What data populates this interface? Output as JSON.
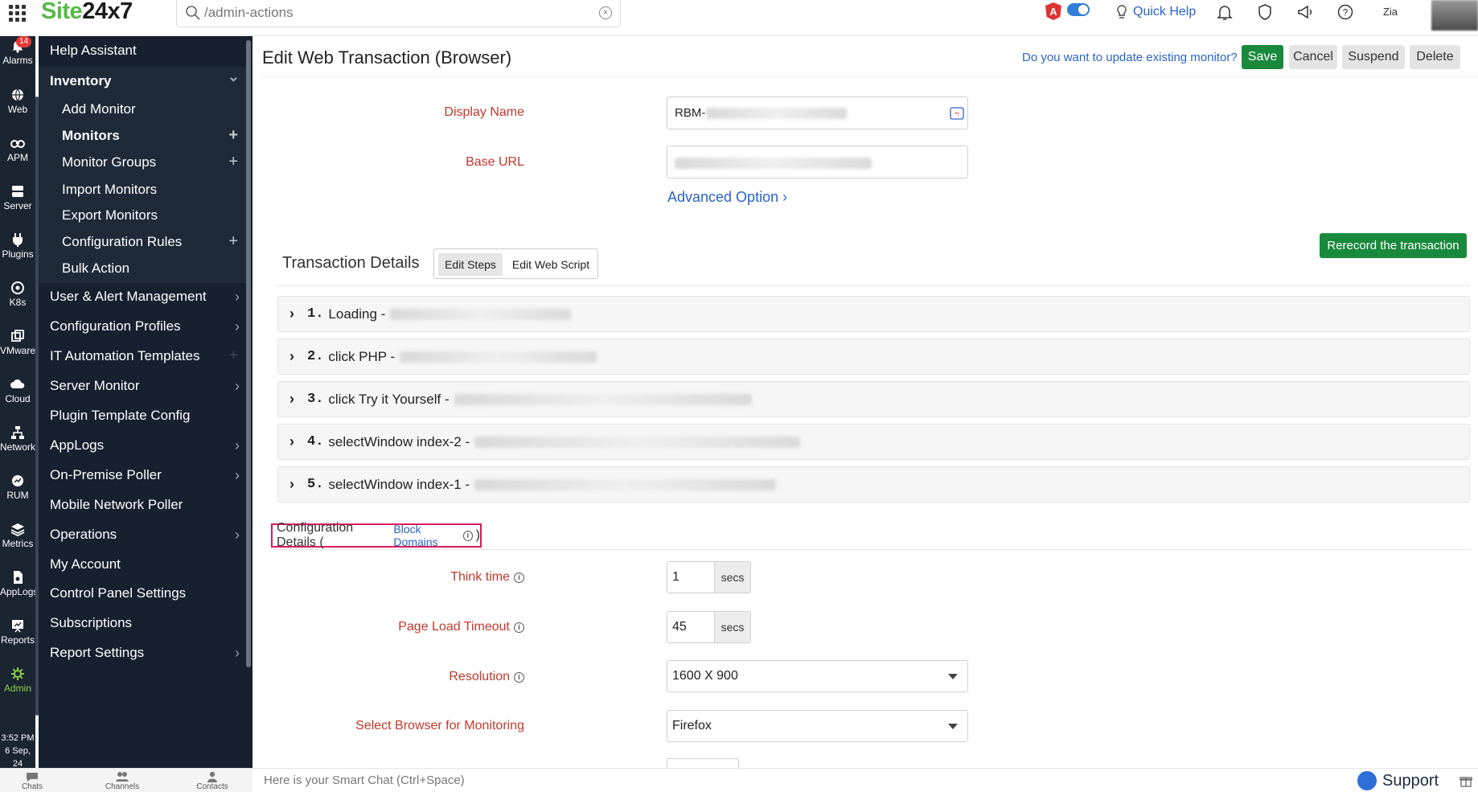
{
  "topbar": {
    "logo_part1": "Site",
    "logo_part2": "24x7",
    "search_value": "/admin-actions",
    "angular_badge": "A",
    "quick_help": "Quick Help"
  },
  "rail": [
    {
      "label": "Alarms",
      "badge": "14",
      "icon": "bell-icon"
    },
    {
      "label": "Web",
      "icon": "globe-icon"
    },
    {
      "label": "APM",
      "icon": "binoculars-icon"
    },
    {
      "label": "Server",
      "icon": "server-icon"
    },
    {
      "label": "Plugins",
      "icon": "plug-icon"
    },
    {
      "label": "K8s",
      "icon": "helm-icon"
    },
    {
      "label": "VMware",
      "icon": "vm-icon"
    },
    {
      "label": "Cloud",
      "icon": "cloud-icon"
    },
    {
      "label": "Network",
      "icon": "network-icon"
    },
    {
      "label": "RUM",
      "icon": "rum-icon"
    },
    {
      "label": "Metrics",
      "icon": "layers-icon"
    },
    {
      "label": "AppLogs",
      "icon": "file-icon"
    },
    {
      "label": "Reports",
      "icon": "chart-icon"
    },
    {
      "label": "Admin",
      "icon": "gear-icon"
    }
  ],
  "rail_time": "3:52 PM",
  "rail_date": "6 Sep, 24",
  "sidebar": [
    {
      "label": "Help Assistant"
    },
    {
      "label": "Inventory",
      "bold": true,
      "open": true
    },
    {
      "label": "Add Monitor",
      "sub": true
    },
    {
      "label": "Monitors",
      "sub": true,
      "bold": true,
      "plus": true
    },
    {
      "label": "Monitor Groups",
      "sub": true,
      "plus": true
    },
    {
      "label": "Import Monitors",
      "sub": true
    },
    {
      "label": "Export Monitors",
      "sub": true
    },
    {
      "label": "Configuration Rules",
      "sub": true,
      "plus": true
    },
    {
      "label": "Bulk Action",
      "sub": true
    },
    {
      "label": "User & Alert Management",
      "arrow": true
    },
    {
      "label": "Configuration Profiles",
      "arrow": true
    },
    {
      "label": "IT Automation Templates",
      "plus": true
    },
    {
      "label": "Server Monitor",
      "arrow": true
    },
    {
      "label": "Plugin Template Config"
    },
    {
      "label": "AppLogs",
      "arrow": true
    },
    {
      "label": "On-Premise Poller",
      "arrow": true
    },
    {
      "label": "Mobile Network Poller"
    },
    {
      "label": "Operations",
      "arrow": true
    },
    {
      "label": "My Account"
    },
    {
      "label": "Control Panel Settings"
    },
    {
      "label": "Subscriptions"
    },
    {
      "label": "Report Settings",
      "arrow": true
    }
  ],
  "bottombar": {
    "chats": "Chats",
    "channels": "Channels",
    "contacts": "Contacts",
    "smart_chat": "Here is your Smart Chat (Ctrl+Space)",
    "support": "Support"
  },
  "main": {
    "title": "Edit Web Transaction (Browser)",
    "update_question": "Do you want to update existing monitor?",
    "save": "Save",
    "cancel": "Cancel",
    "suspend": "Suspend",
    "delete": "Delete",
    "display_name_label": "Display Name",
    "display_name_value": "RBM-",
    "base_url_label": "Base URL",
    "advanced_option": "Advanced Option",
    "rerecord": "Rerecord the transaction",
    "transaction_details": "Transaction Details",
    "edit_steps": "Edit Steps",
    "edit_web_script": "Edit Web Script",
    "steps": [
      {
        "num": "1.",
        "label": "Loading -"
      },
      {
        "num": "2.",
        "label": "click PHP -"
      },
      {
        "num": "3.",
        "label": "click Try it Yourself -"
      },
      {
        "num": "4.",
        "label": "selectWindow index-2 -"
      },
      {
        "num": "5.",
        "label": "selectWindow index-1 -"
      }
    ],
    "config_details": "Configuration Details (",
    "block_domains": "Block Domains",
    "config_close": ")",
    "think_time_label": "Think time",
    "think_time_value": "1",
    "think_time_unit": "secs",
    "page_load_label": "Page Load Timeout",
    "page_load_value": "45",
    "page_load_unit": "secs",
    "resolution_label": "Resolution",
    "resolution_value": "1600 X 900",
    "browser_label": "Select Browser for Monitoring",
    "browser_value": "Firefox"
  },
  "colors": {
    "accent_green": "#198a3d",
    "link_blue": "#2a64c5",
    "label_red": "#c0392b",
    "highlight_pink": "#d81b60",
    "sidebar_bg": "#16202e"
  }
}
